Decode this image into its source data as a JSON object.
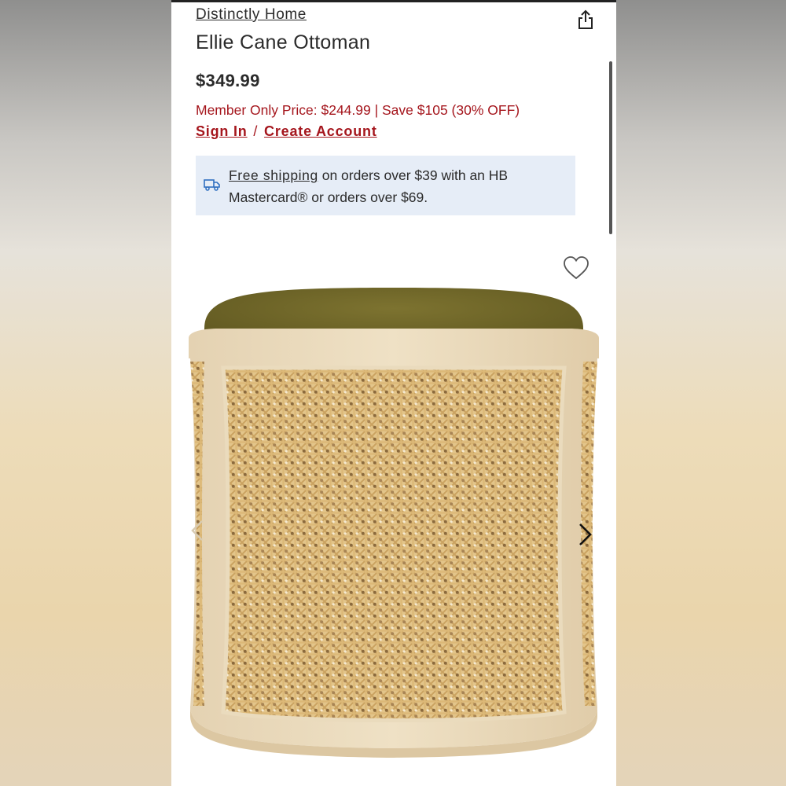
{
  "header": {
    "brand": "Distinctly Home",
    "share_icon": "share-icon"
  },
  "product": {
    "title": "Ellie Cane Ottoman",
    "price": "$349.99",
    "member_price": "Member Only Price: $244.99 | Save $105 (30% OFF)",
    "sign_in": "Sign In",
    "separator": "/",
    "create_account": "Create Account"
  },
  "shipping": {
    "icon": "truck-icon",
    "link": "Free shipping",
    "text": " on orders over $39 with an HB Mastercard® or orders over $69."
  },
  "gallery": {
    "favorite_icon": "heart-icon",
    "prev_icon": "chevron-left-icon",
    "next_icon": "chevron-right-icon"
  },
  "colors": {
    "accent": "#a5161d",
    "shipping_bg": "#e6edf7",
    "text": "#2b2b2b"
  }
}
